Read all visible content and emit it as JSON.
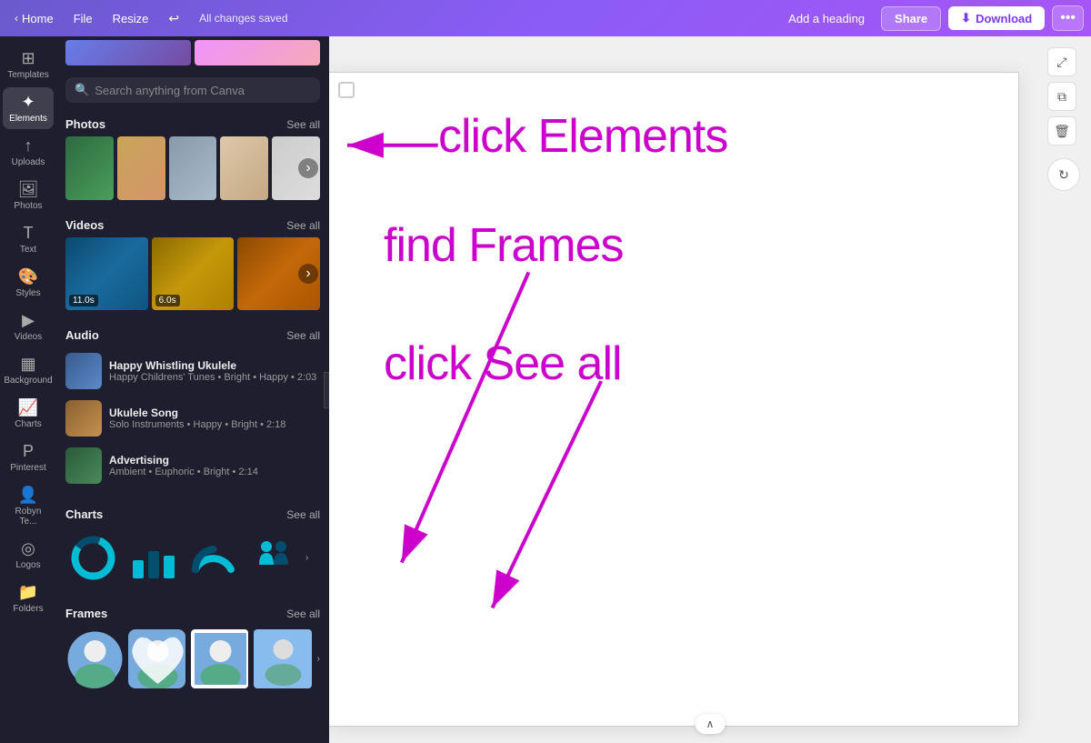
{
  "topbar": {
    "home_label": "Home",
    "file_label": "File",
    "resize_label": "Resize",
    "saved_text": "All changes saved",
    "add_heading_label": "Add a heading",
    "share_label": "Share",
    "download_label": "Download",
    "more_icon": "•••"
  },
  "sidebar": {
    "items": [
      {
        "id": "templates",
        "label": "Templates",
        "icon": "⊞"
      },
      {
        "id": "elements",
        "label": "Elements",
        "icon": "✦",
        "active": true
      },
      {
        "id": "uploads",
        "label": "Uploads",
        "icon": "↑"
      },
      {
        "id": "photos",
        "label": "Photos",
        "icon": "🖼"
      },
      {
        "id": "text",
        "label": "Text",
        "icon": "T"
      },
      {
        "id": "styles",
        "label": "Styles",
        "icon": "🎨"
      },
      {
        "id": "videos",
        "label": "Videos",
        "icon": "▶"
      },
      {
        "id": "background",
        "label": "Background",
        "icon": "▦"
      },
      {
        "id": "charts",
        "label": "Charts",
        "icon": "📈"
      },
      {
        "id": "pinterest",
        "label": "Pinterest",
        "icon": "P"
      },
      {
        "id": "robyn",
        "label": "Robyn Te...",
        "icon": "👤"
      },
      {
        "id": "logos",
        "label": "Logos",
        "icon": "◎"
      },
      {
        "id": "folders",
        "label": "Folders",
        "icon": "📁"
      }
    ]
  },
  "search": {
    "placeholder": "Search anything from Canva"
  },
  "panels": {
    "photos": {
      "title": "Photos",
      "see_all": "See all"
    },
    "videos": {
      "title": "Videos",
      "see_all": "See all",
      "items": [
        {
          "duration": "11.0s"
        },
        {
          "duration": "6.0s"
        }
      ]
    },
    "audio": {
      "title": "Audio",
      "see_all": "See all",
      "items": [
        {
          "title": "Happy Whistling Ukulele",
          "meta": "Happy Childrens' Tunes • Bright • Happy",
          "duration": "2:03"
        },
        {
          "title": "Ukulele Song",
          "meta": "Solo Instruments • Happy • Bright",
          "duration": "2:18"
        },
        {
          "title": "Advertising",
          "meta": "Ambient • Euphoric • Bright",
          "duration": "2:14"
        }
      ]
    },
    "charts": {
      "title": "Charts",
      "see_all": "See all"
    },
    "frames": {
      "title": "Frames",
      "see_all": "See all"
    }
  },
  "annotations": {
    "text1": "click Elements",
    "text2": "find Frames",
    "text3": "click See all"
  },
  "canvas": {
    "page_nav_label": "∧"
  }
}
